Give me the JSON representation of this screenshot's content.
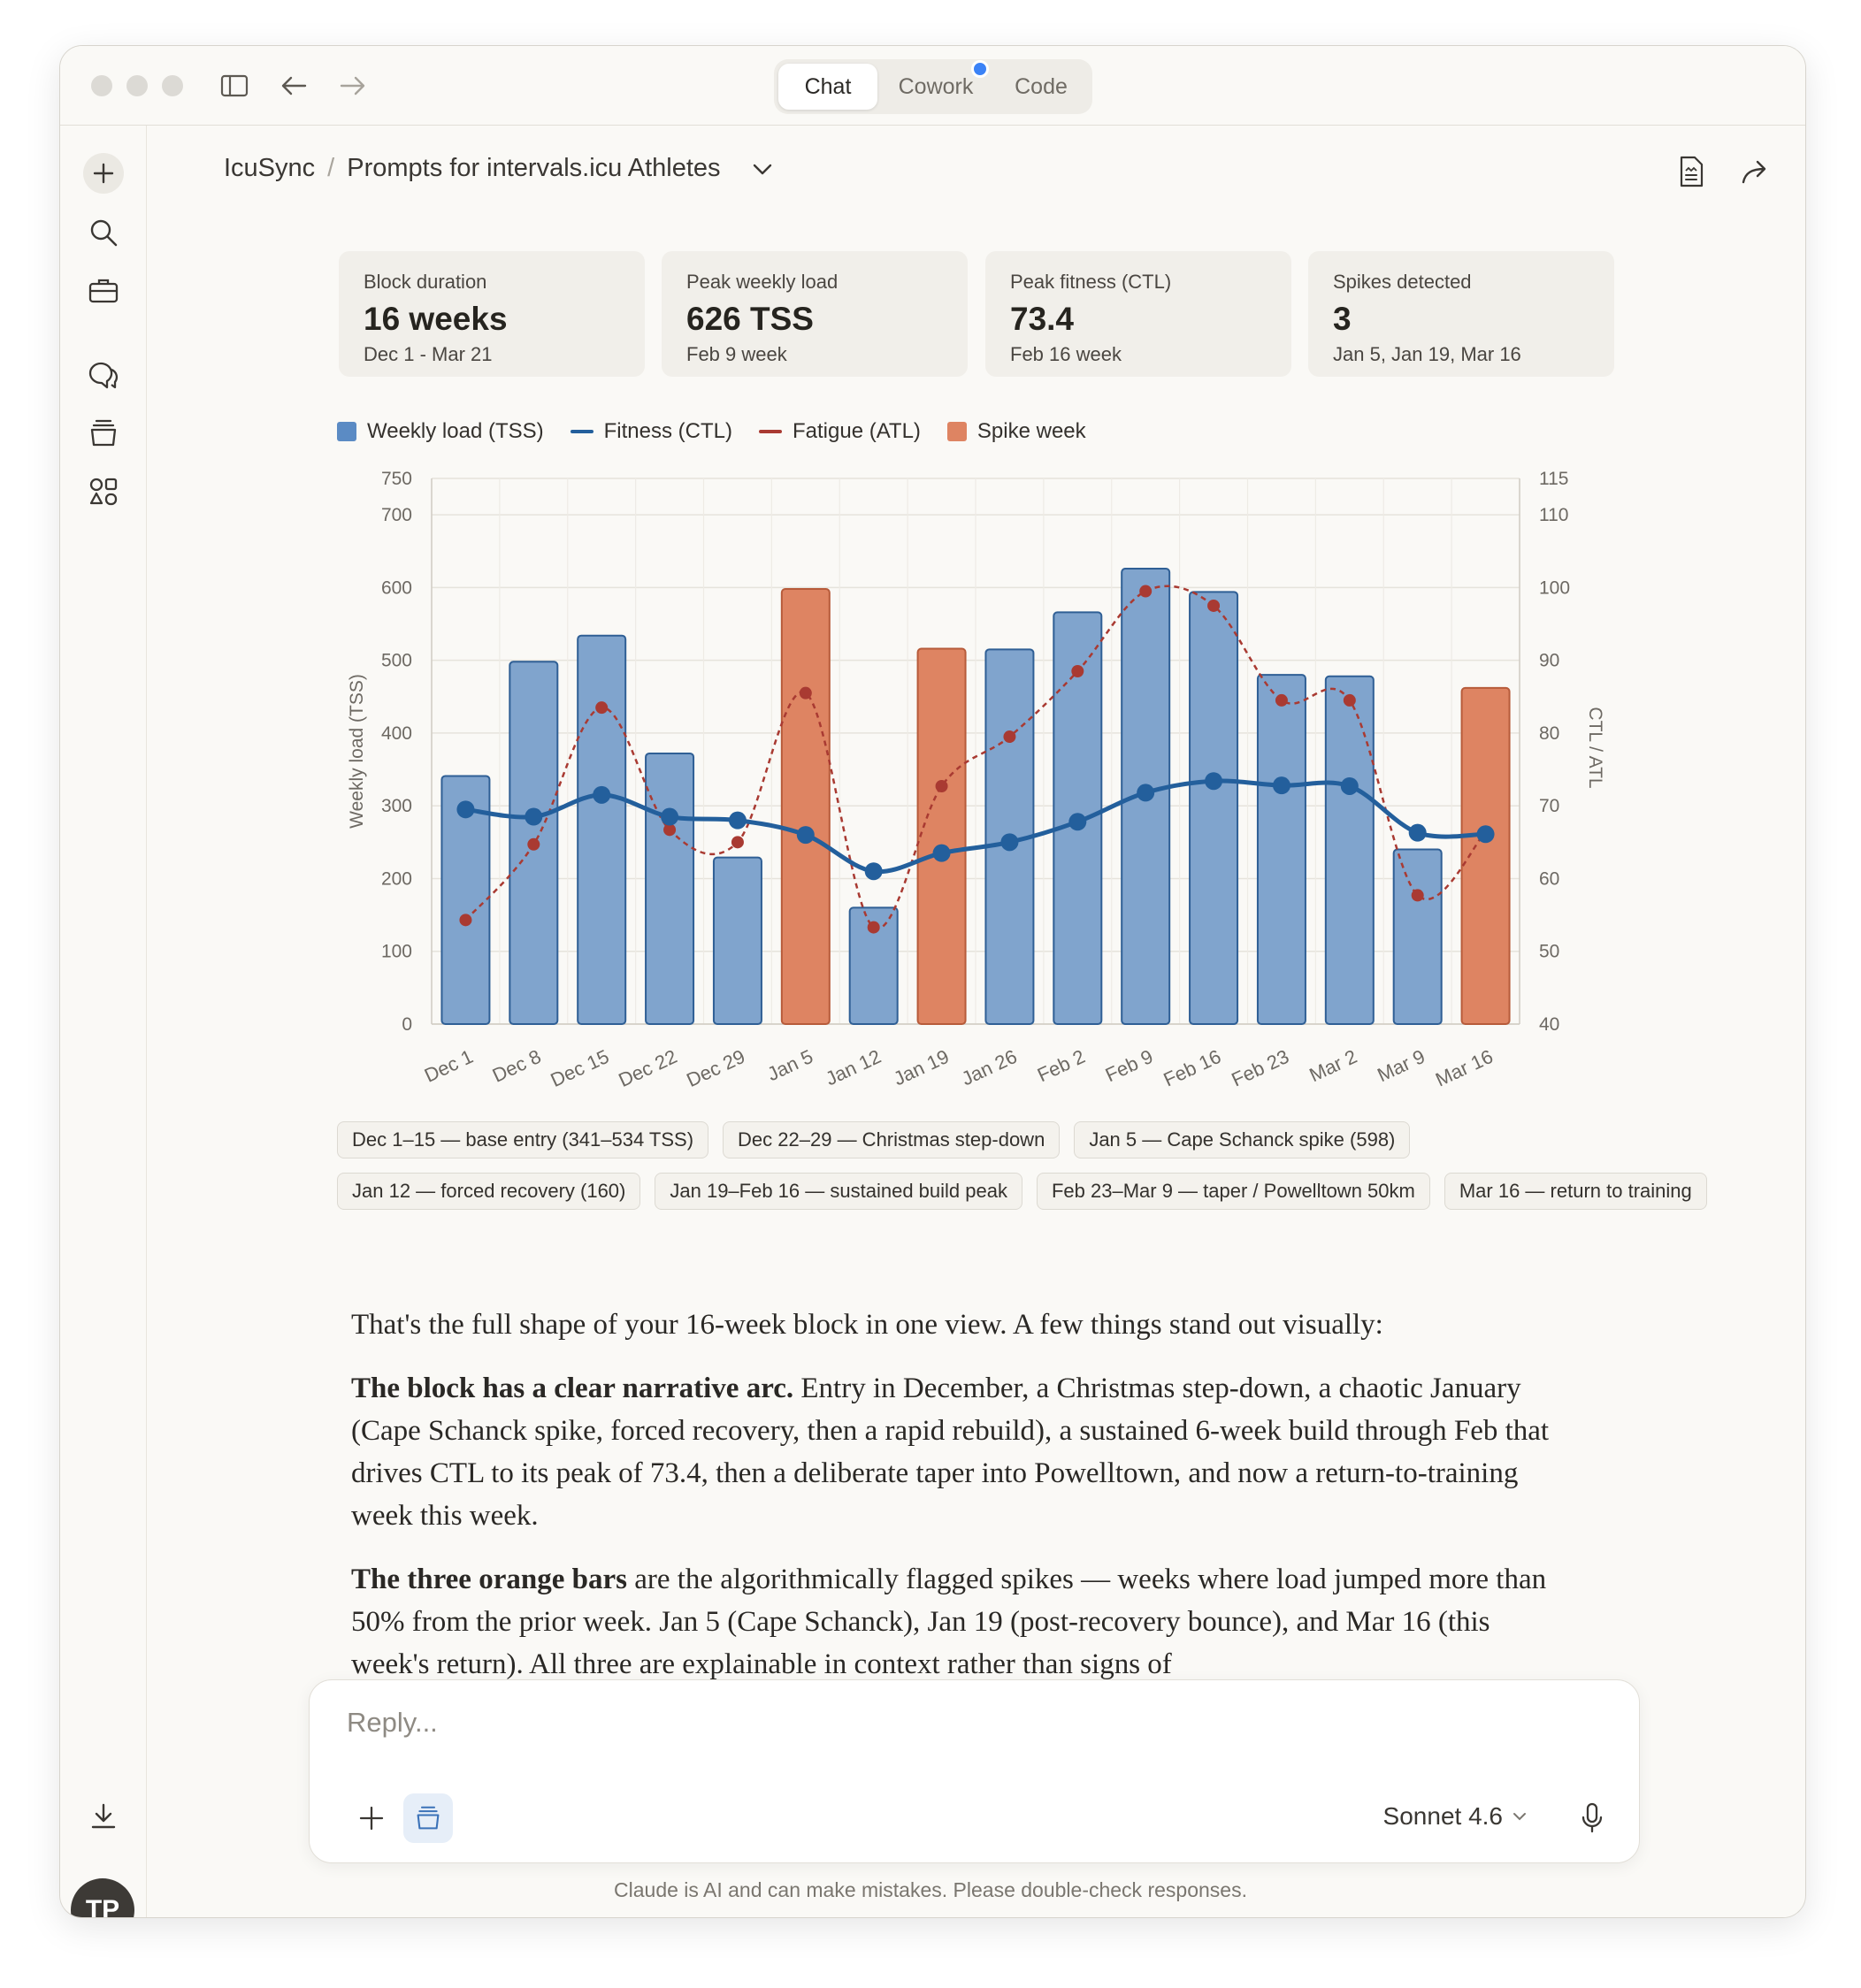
{
  "app": {
    "modes": [
      "Chat",
      "Cowork",
      "Code"
    ],
    "active_mode": "Chat"
  },
  "breadcrumb": {
    "project": "IcuSync",
    "separator": "/",
    "title": "Prompts for intervals.icu Athletes"
  },
  "sidebar": {
    "icons": [
      "plus-icon",
      "search-icon",
      "briefcase-icon",
      "chats-icon",
      "projects-icon",
      "artifacts-icon",
      "download-icon"
    ],
    "avatar_initials": "TP"
  },
  "stats": [
    {
      "label": "Block duration",
      "value": "16 weeks",
      "sub": "Dec 1 - Mar 21"
    },
    {
      "label": "Peak weekly load",
      "value": "626 TSS",
      "sub": "Feb 9 week"
    },
    {
      "label": "Peak fitness (CTL)",
      "value": "73.4",
      "sub": "Feb 16 week"
    },
    {
      "label": "Spikes detected",
      "value": "3",
      "sub": "Jan 5, Jan 19, Mar 16"
    }
  ],
  "chart_data": {
    "type": "bar",
    "categories": [
      "Dec 1",
      "Dec 8",
      "Dec 15",
      "Dec 22",
      "Dec 29",
      "Jan 5",
      "Jan 12",
      "Jan 19",
      "Jan 26",
      "Feb 2",
      "Feb 9",
      "Feb 16",
      "Feb 23",
      "Mar 2",
      "Mar 9",
      "Mar 16"
    ],
    "series": [
      {
        "name": "Weekly load (TSS)",
        "axis": "left",
        "type": "bar",
        "values": [
          341,
          498,
          534,
          372,
          229,
          598,
          160,
          516,
          515,
          566,
          626,
          594,
          480,
          478,
          240,
          462
        ]
      },
      {
        "name": "Fitness (CTL)",
        "axis": "right",
        "type": "line",
        "values": [
          69.5,
          68.5,
          71.5,
          68.5,
          68,
          66,
          61,
          63.5,
          65,
          67.8,
          71.8,
          73.4,
          72.8,
          72.7,
          66.3,
          66.1
        ]
      },
      {
        "name": "Fatigue (ATL)",
        "axis": "right",
        "type": "line",
        "style": "dashed",
        "values": [
          54.3,
          64.7,
          83.5,
          66.7,
          65,
          85.5,
          53.3,
          72.7,
          79.5,
          88.5,
          99.5,
          97.5,
          84.5,
          84.5,
          57.7,
          66.4
        ]
      }
    ],
    "spike_weeks": [
      "Jan 5",
      "Jan 19",
      "Mar 16"
    ],
    "legend": [
      "Weekly load (TSS)",
      "Fitness (CTL)",
      "Fatigue (ATL)",
      "Spike week"
    ],
    "legend_position": "top-left",
    "ylabel": "Weekly load (TSS)",
    "y2label": "CTL / ATL",
    "ylim": [
      0,
      750
    ],
    "y2lim": [
      40,
      115
    ],
    "yticks": [
      "0",
      "100",
      "200",
      "300",
      "400",
      "500",
      "600",
      "700",
      "750"
    ],
    "y2ticks": [
      "40",
      "50",
      "60",
      "70",
      "80",
      "90",
      "100",
      "110",
      "115"
    ],
    "grid": true,
    "colors": {
      "bar": "#80a4cd",
      "bar_edge": "#2f5f95",
      "spike": "#de8462",
      "spike_edge": "#b75b3a",
      "ctl": "#235f9c",
      "atl": "#a93a32"
    }
  },
  "annotations": [
    "Dec 1–15 — base entry (341–534 TSS)",
    "Dec 22–29 — Christmas step-down",
    "Jan 5 — Cape Schanck spike (598)",
    "Jan 12 — forced recovery (160)",
    "Jan 19–Feb 16 — sustained build peak",
    "Feb 23–Mar 9 — taper / Powelltown 50km",
    "Mar 16 — return to training"
  ],
  "message": {
    "p1": "That's the full shape of your 16-week block in one view. A few things stand out visually:",
    "p2_bold": "The block has a clear narrative arc.",
    "p2": " Entry in December, a Christmas step-down, a chaotic January (Cape Schanck spike, forced recovery, then a rapid rebuild), a sustained 6-week build through Feb that drives CTL to its peak of 73.4, then a deliberate taper into Powelltown, and now a return-to-training week this week.",
    "p3_bold": "The three orange bars",
    "p3": " are the algorithmically flagged spikes — weeks where load jumped more than 50% from the prior week. Jan 5 (Cape Schanck), Jan 19 (post-recovery bounce), and Mar 16 (this week's return). All three are explainable in context rather than signs of"
  },
  "composer": {
    "placeholder": "Reply...",
    "model": "Sonnet 4.6"
  },
  "disclaimer": "Claude is AI and can make mistakes. Please double-check responses."
}
